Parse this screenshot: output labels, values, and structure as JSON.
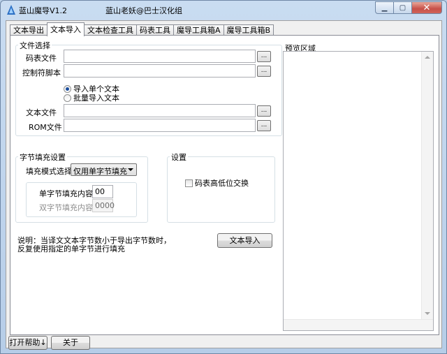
{
  "window": {
    "title": "蓝山魔导V1.2",
    "subtitle": "蓝山老妖@巴士汉化组"
  },
  "tabs": [
    {
      "label": "文本导出",
      "active": false
    },
    {
      "label": "文本导入",
      "active": true
    },
    {
      "label": "文本检查工具",
      "active": false
    },
    {
      "label": "码表工具",
      "active": false
    },
    {
      "label": "魔导工具箱A",
      "active": false
    },
    {
      "label": "魔导工具箱B",
      "active": false
    }
  ],
  "file_select": {
    "group_label": "文件选择",
    "code_table_label": "码表文件",
    "code_table_value": "",
    "control_script_label": "控制符脚本",
    "control_script_value": "",
    "radio_single": "导入单个文本",
    "radio_batch": "批量导入文本",
    "text_file_label": "文本文件",
    "text_file_value": "",
    "rom_file_label": "ROM文件",
    "rom_file_value": "",
    "browse_label": "..."
  },
  "byte_fill": {
    "group_label": "字节填充设置",
    "mode_label": "填充模式选择",
    "mode_value": "仅用单字节填充",
    "single_label": "单字节填充内容",
    "single_value": "00",
    "double_label": "双字节填充内容",
    "double_value": "0000"
  },
  "settings": {
    "group_label": "设置",
    "swap_checkbox": "码表高低位交换"
  },
  "note": {
    "line1": "说明：当译文文本字节数小于导出字节数时，",
    "line2": "反复使用指定的单字节进行填充"
  },
  "import_button": "文本导入",
  "preview": {
    "label": "预览区域"
  },
  "footer": {
    "help_button": "打开帮助↓",
    "about_button": "关于"
  },
  "colors": {
    "accent": "#1b4e9e",
    "close_button": "#c75049"
  }
}
